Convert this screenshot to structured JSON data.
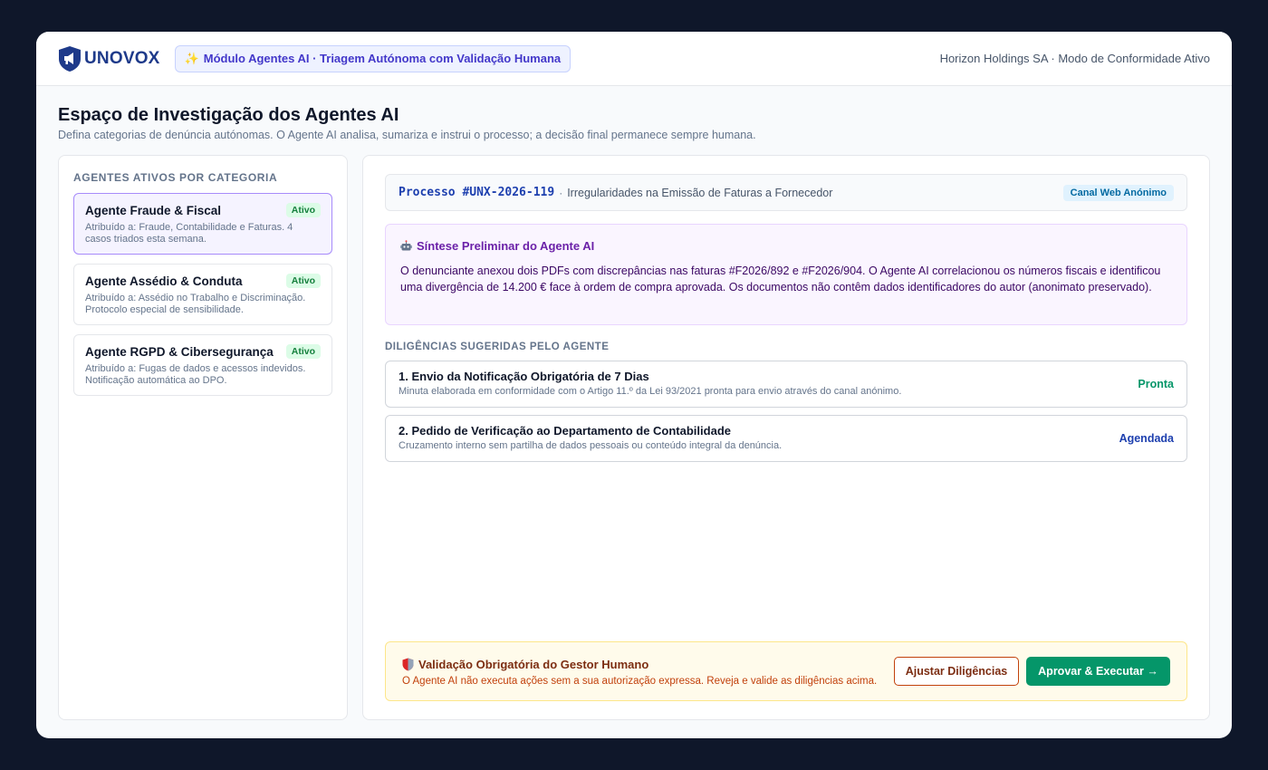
{
  "header": {
    "logo_text": "UNOVOX",
    "module_badge_icon": "✨",
    "module_badge": "Módulo Agentes AI · Triagem Autónoma com Validação Humana",
    "org_status": "Horizon Holdings SA · Modo de Conformidade Ativo"
  },
  "page": {
    "title": "Espaço de Investigação dos Agentes AI",
    "subtitle": "Defina categorias de denúncia autónomas. O Agente AI analisa, sumariza e instrui o processo; a decisão final permanece sempre humana."
  },
  "sidebar": {
    "label": "AGENTES ATIVOS POR CATEGORIA",
    "agents": [
      {
        "name": "Agente Fraude & Fiscal",
        "status": "Ativo",
        "description": "Atribuído a: Fraude, Contabilidade e Faturas. 4 casos triados esta semana."
      },
      {
        "name": "Agente Assédio & Conduta",
        "status": "Ativo",
        "description": "Atribuído a: Assédio no Trabalho e Discriminação. Protocolo especial de sensibilidade."
      },
      {
        "name": "Agente RGPD & Cibersegurança",
        "status": "Ativo",
        "description": "Atribuído a: Fugas de dados e acessos indevidos. Notificação automática ao DPO."
      }
    ]
  },
  "case": {
    "id": "Processo #UNX-2026-119",
    "separator": "·",
    "title": "Irregularidades na Emissão de Faturas a Fornecedor",
    "channel": "Canal Web Anónimo"
  },
  "summary": {
    "title": "Síntese Preliminar do Agente AI",
    "text": "O denunciante anexou dois PDFs com discrepâncias nas faturas #F2026/892 e #F2026/904. O Agente AI correlacionou os números fiscais e identificou uma divergência de 14.200 € face à ordem de compra aprovada. Os documentos não contêm dados identificadores do autor (anonimato preservado)."
  },
  "diligences": {
    "label": "DILIGÊNCIAS SUGERIDAS PELO AGENTE",
    "items": [
      {
        "title": "1. Envio da Notificação Obrigatória de 7 Dias",
        "description": "Minuta elaborada em conformidade com o Artigo 11.º da Lei 93/2021 pronta para envio através do canal anónimo.",
        "status": "Pronta"
      },
      {
        "title": "2. Pedido de Verificação ao Departamento de Contabilidade",
        "description": "Cruzamento interno sem partilha de dados pessoais ou conteúdo integral da denúncia.",
        "status": "Agendada"
      }
    ]
  },
  "approval": {
    "title": "Validação Obrigatória do Gestor Humano",
    "description": "O Agente AI não executa ações sem a sua autorização expressa. Reveja e valide as diligências acima.",
    "adjust_label": "Ajustar Diligências",
    "approve_label": "Aprovar & Executar →"
  },
  "colors": {
    "brand": "#1e3a8a",
    "accent_purple": "#6b21a8",
    "success": "#059669",
    "warning_text": "#c2410c"
  },
  "icons": {
    "logo": "shield-megaphone-icon",
    "summary": "robot-icon",
    "approval": "shield-icon"
  }
}
